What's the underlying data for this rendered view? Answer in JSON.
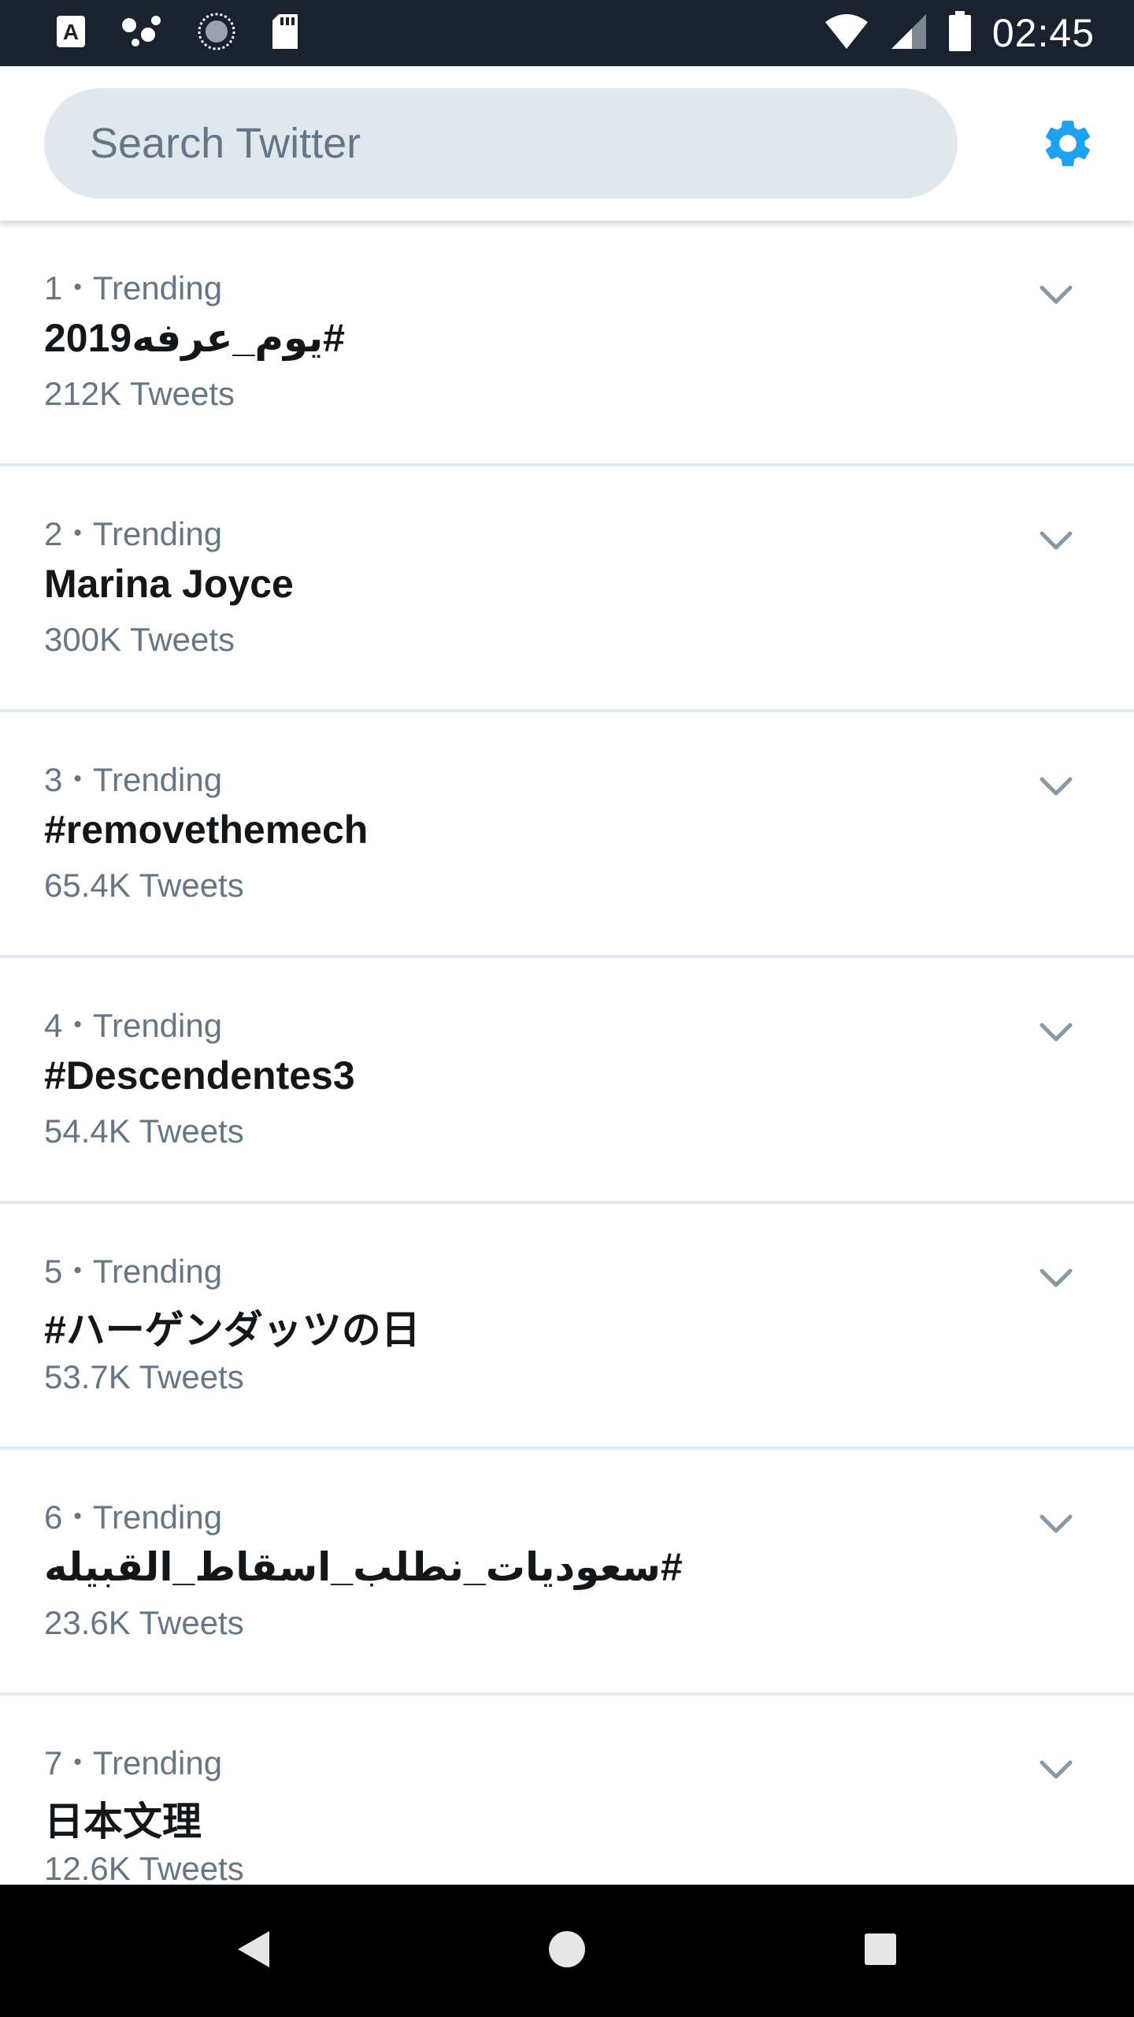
{
  "status_bar": {
    "time": "02:45",
    "icons": [
      "keyboard-a-icon",
      "dots-icon",
      "sync-circle-icon",
      "sd-card-icon",
      "wifi-icon",
      "cell-signal-icon",
      "battery-icon"
    ]
  },
  "search": {
    "placeholder": "Search Twitter",
    "value": ""
  },
  "header": {
    "settings_icon": "gear-icon"
  },
  "trends": [
    {
      "rank": "1",
      "label": "Trending",
      "name": "#يوم_عرفه2019",
      "count": "212K Tweets"
    },
    {
      "rank": "2",
      "label": "Trending",
      "name": "Marina Joyce",
      "count": "300K Tweets"
    },
    {
      "rank": "3",
      "label": "Trending",
      "name": "#removethemech",
      "count": "65.4K Tweets"
    },
    {
      "rank": "4",
      "label": "Trending",
      "name": "#Descendentes3",
      "count": "54.4K Tweets"
    },
    {
      "rank": "5",
      "label": "Trending",
      "name": "#ハーゲンダッツの日",
      "count": "53.7K Tweets"
    },
    {
      "rank": "6",
      "label": "Trending",
      "name": "#سعوديات_نطلب_اسقاط_القبيله",
      "count": "23.6K Tweets"
    },
    {
      "rank": "7",
      "label": "Trending",
      "name": "日本文理",
      "count": "12.6K Tweets"
    }
  ],
  "nav_bar": {
    "buttons": [
      "back-icon",
      "home-icon",
      "recents-icon"
    ]
  },
  "colors": {
    "accent": "#1da1f2",
    "text_primary": "#14171a",
    "text_secondary": "#657786",
    "divider": "#e1e8ed",
    "status_bar_bg": "#1a2230"
  }
}
